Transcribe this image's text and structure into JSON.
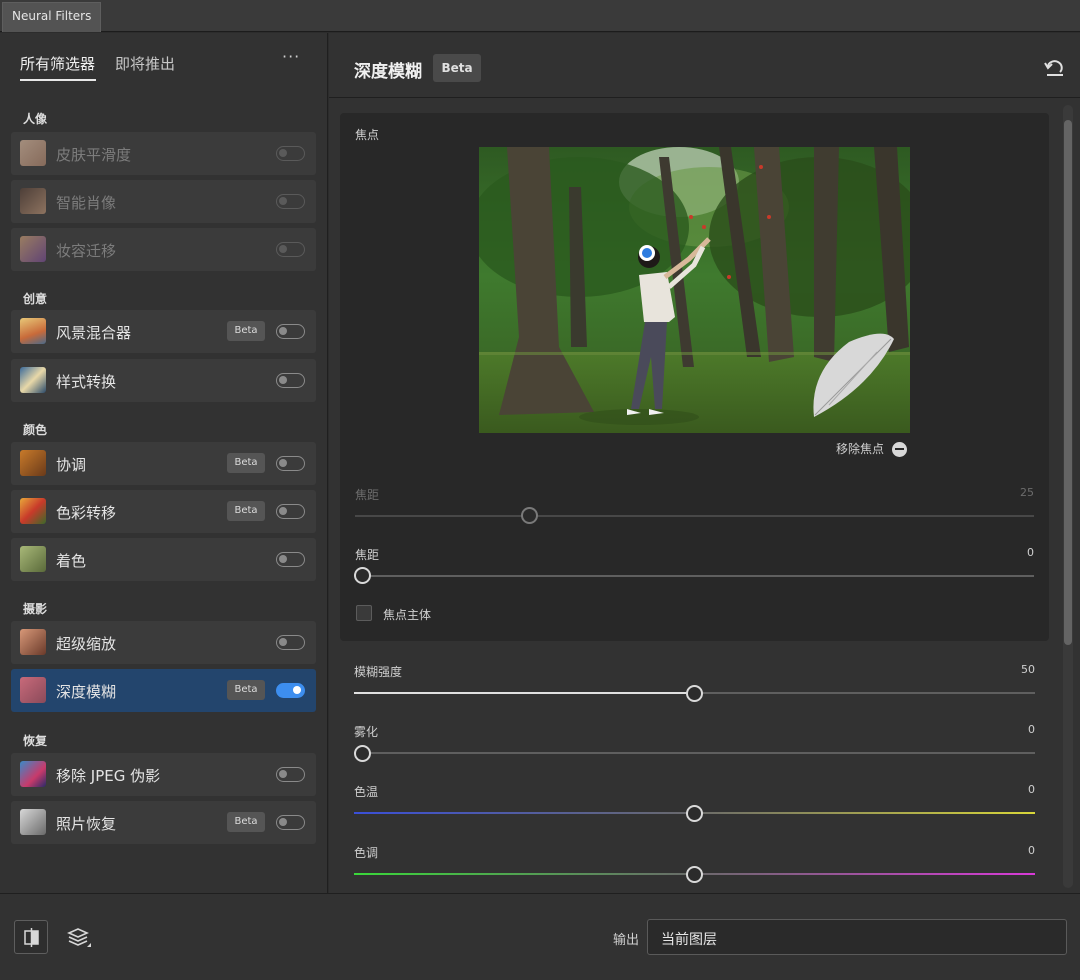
{
  "window": {
    "title": "Neural Filters"
  },
  "left": {
    "tabs": [
      {
        "label": "所有筛选器",
        "active": true
      },
      {
        "label": "即将推出",
        "active": false
      }
    ],
    "more_label": "···",
    "categories": [
      {
        "label": "人像"
      },
      {
        "label": "创意"
      },
      {
        "label": "颜色"
      },
      {
        "label": "摄影"
      },
      {
        "label": "恢复"
      }
    ],
    "items": [
      {
        "name": "皮肤平滑度",
        "beta": "",
        "enabled": false,
        "on": false
      },
      {
        "name": "智能肖像",
        "beta": "",
        "enabled": false,
        "on": false
      },
      {
        "name": "妆容迁移",
        "beta": "",
        "enabled": false,
        "on": false
      },
      {
        "name": "风景混合器",
        "beta": "Beta",
        "enabled": true,
        "on": false
      },
      {
        "name": "样式转换",
        "beta": "",
        "enabled": true,
        "on": false
      },
      {
        "name": "协调",
        "beta": "Beta",
        "enabled": true,
        "on": false
      },
      {
        "name": "色彩转移",
        "beta": "Beta",
        "enabled": true,
        "on": false
      },
      {
        "name": "着色",
        "beta": "",
        "enabled": true,
        "on": false
      },
      {
        "name": "超级缩放",
        "beta": "",
        "enabled": true,
        "on": false
      },
      {
        "name": "深度模糊",
        "beta": "Beta",
        "enabled": true,
        "on": true,
        "selected": true
      },
      {
        "name": "移除 JPEG 伪影",
        "beta": "",
        "enabled": true,
        "on": false
      },
      {
        "name": "照片恢复",
        "beta": "Beta",
        "enabled": true,
        "on": false
      }
    ]
  },
  "right": {
    "title": "深度模糊",
    "beta": "Beta",
    "focus": {
      "label": "焦点",
      "remove_label": "移除焦点",
      "focal_distance_disabled": {
        "label": "焦距",
        "value": "25"
      },
      "focal_range": {
        "label": "焦距",
        "value": "0"
      },
      "focus_subject_label": "焦点主体"
    },
    "sliders": [
      {
        "label": "模糊强度",
        "value": "50",
        "level": 0.5
      },
      {
        "label": "雾化",
        "value": "0",
        "level": 0.0
      },
      {
        "label": "色温",
        "value": "0",
        "level": 0.5
      },
      {
        "label": "色调",
        "value": "0",
        "level": 0.5
      }
    ]
  },
  "footer": {
    "output_label": "输出",
    "output_value": "当前图层"
  },
  "colors": {
    "accent": "#3d8eef",
    "selected_row": "#23456d",
    "temp_cold": "#3a4fd8",
    "temp_warm": "#d8d63a",
    "tint_green": "#3ad83a",
    "tint_magenta": "#d83ad8"
  }
}
